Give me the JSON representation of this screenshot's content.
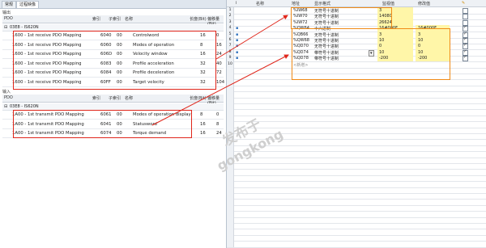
{
  "left": {
    "tabs": [
      "常规",
      "过程映像"
    ],
    "output_title": "输出",
    "input_title": "输入",
    "columns": {
      "pdo": "PDO",
      "index": "索引",
      "subindex": "子索引",
      "name": "名称",
      "length": "长度(Bit)",
      "offset": "偏移量(Bit)"
    },
    "output_group": "03E8 - IS620N",
    "input_group": "03E8 - IS620N",
    "outputs": [
      {
        "pdo": "1600 - 1st receive PDO Mapping",
        "index": "6040",
        "sub": "00",
        "name": "Controlword",
        "len": "16",
        "off": "0"
      },
      {
        "pdo": "1600 - 1st receive PDO Mapping",
        "index": "6060",
        "sub": "00",
        "name": "Modes of operation",
        "len": "8",
        "off": "16"
      },
      {
        "pdo": "1600 - 1st receive PDO Mapping",
        "index": "606D",
        "sub": "00",
        "name": "Velocity window",
        "len": "16",
        "off": "24"
      },
      {
        "pdo": "1600 - 1st receive PDO Mapping",
        "index": "6083",
        "sub": "00",
        "name": "Profile acceleration",
        "len": "32",
        "off": "40"
      },
      {
        "pdo": "1600 - 1st receive PDO Mapping",
        "index": "6084",
        "sub": "00",
        "name": "Profile deceleration",
        "len": "32",
        "off": "72"
      },
      {
        "pdo": "1600 - 1st receive PDO Mapping",
        "index": "60FF",
        "sub": "00",
        "name": "Target velocity",
        "len": "32",
        "off": "104"
      }
    ],
    "inputs": [
      {
        "pdo": "1A00 - 1st transmit PDO Mapping",
        "index": "6061",
        "sub": "00",
        "name": "Modes of operation display",
        "len": "8",
        "off": "0"
      },
      {
        "pdo": "1A00 - 1st transmit PDO Mapping",
        "index": "6041",
        "sub": "00",
        "name": "Statusword",
        "len": "16",
        "off": "8"
      },
      {
        "pdo": "1A00 - 1st transmit PDO Mapping",
        "index": "6074",
        "sub": "00",
        "name": "Torque demand",
        "len": "16",
        "off": "24"
      }
    ]
  },
  "right": {
    "columns": {
      "i": "i",
      "name": "名称",
      "address": "地址",
      "format": "显示格式",
      "monitor": "监视值",
      "modify": "修改值"
    },
    "rows": [
      {
        "num": "1",
        "addr": "%IW68",
        "fmt": "无符号十进制",
        "mon": "3",
        "mod": "",
        "check": false
      },
      {
        "num": "2",
        "addr": "%IW70",
        "fmt": "无符号十进制",
        "mon": "14080",
        "mod": "",
        "check": false
      },
      {
        "num": "3",
        "addr": "%IW72",
        "fmt": "无符号十进制",
        "mon": "26624",
        "mod": "",
        "check": false
      },
      {
        "num": "4",
        "addr": "%QW64",
        "fmt": "十六进制",
        "mon": "16#000F",
        "mod": "16#000F",
        "check": true
      },
      {
        "num": "5",
        "addr": "%QB66",
        "fmt": "无符号十进制",
        "mon": "3",
        "mod": "3",
        "check": true
      },
      {
        "num": "6",
        "addr": "%QW68",
        "fmt": "无符号十进制",
        "mon": "10",
        "mod": "10",
        "check": true
      },
      {
        "num": "7",
        "addr": "%QD70",
        "fmt": "无符号十进制",
        "mon": "0",
        "mod": "0",
        "check": true
      },
      {
        "num": "8",
        "addr": "%QD74",
        "fmt": "带符号十进制",
        "mon": "10",
        "mod": "10",
        "check": true
      },
      {
        "num": "9",
        "addr": "%QD78",
        "fmt": "带符号十进制",
        "mon": "-200",
        "mod": "-200",
        "check": true
      },
      {
        "num": "10",
        "addr": "<新增>",
        "fmt": "",
        "mon": "",
        "mod": "",
        "check": false
      }
    ]
  },
  "watermark": {
    "cn": "发布于",
    "en": "gongkong"
  },
  "colors": {
    "highlight_red": "#e0261b",
    "highlight_orange": "#f08a17",
    "value_yellow": "#fff6a8"
  }
}
